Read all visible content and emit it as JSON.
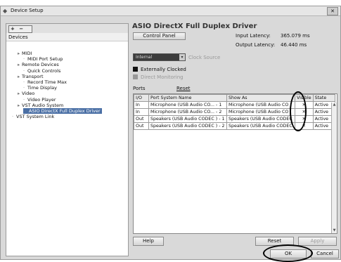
{
  "window": {
    "title": "Device Setup",
    "close_label": "✕"
  },
  "left_panel": {
    "toolbar_label": "+ − ⏮",
    "header": "Devices",
    "tree": [
      {
        "label": "MIDI",
        "level": 1
      },
      {
        "label": "MIDI Port Setup",
        "level": 2
      },
      {
        "label": "Remote Devices",
        "level": 1
      },
      {
        "label": "Quick Controls",
        "level": 2
      },
      {
        "label": "Transport",
        "level": 1
      },
      {
        "label": "Record Time Max",
        "level": 2
      },
      {
        "label": "Time Display",
        "level": 2
      },
      {
        "label": "Video",
        "level": 1
      },
      {
        "label": "Video Player",
        "level": 2
      },
      {
        "label": "VST Audio System",
        "level": 1
      },
      {
        "label": "ASIO DirectX Full Duplex Driver",
        "level": 2,
        "selected": true
      },
      {
        "label": "VST System Link",
        "level": 0
      }
    ]
  },
  "main": {
    "heading": "ASIO DirectX Full Duplex Driver",
    "control_panel_label": "Control Panel",
    "input_latency_label": "Input Latency:",
    "input_latency_value": "365.079 ms",
    "output_latency_label": "Output Latency:",
    "output_latency_value": "46.440 ms",
    "clock_select_value": "Internal",
    "clock_source_label": "Clock Source",
    "externally_clocked_label": "Externally Clocked",
    "direct_monitoring_label": "Direct Monitoring",
    "ports_label": "Ports",
    "reset_link_label": "Reset",
    "table": {
      "headers": [
        "I/O",
        "Port System Name",
        "Show As",
        "Visible",
        "State"
      ],
      "rows": [
        [
          "In",
          "Microphone (USB Audio CO... - 1",
          "Microphone (USB Audio CO",
          "✕",
          "Active"
        ],
        [
          "In",
          "Microphone (USB Audio CO... - 2",
          "Microphone (USB Audio CO",
          "✕",
          "Active"
        ],
        [
          "Out",
          "Speakers (USB Audio CODEC ) - 1",
          "Speakers (USB Audio CODEC",
          "✕",
          "Active"
        ],
        [
          "Out",
          "Speakers (USB Audio CODEC ) - 2",
          "Speakers (USB Audio CODEC",
          "✕",
          "Active"
        ]
      ]
    },
    "help_label": "Help",
    "reset_button_label": "Reset",
    "apply_button_label": "Apply"
  },
  "footer": {
    "ok_label": "OK",
    "cancel_label": "Cancel"
  }
}
